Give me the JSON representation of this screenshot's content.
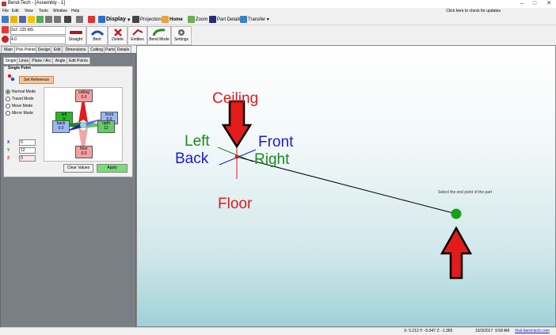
{
  "window": {
    "title": "Bend-Tech - [Assembly - 1]",
    "minimize": "–",
    "maximize": "□",
    "close": "✕"
  },
  "menu": [
    "File",
    "Edit",
    "View",
    "Tools",
    "Window",
    "Help"
  ],
  "update_notice": "Click here to check for updates",
  "toolbar": {
    "display": "Display",
    "projections": "Projections",
    "home": "Home",
    "zoom": "Zoom",
    "part_details": "Part Details",
    "transfer": "Transfer"
  },
  "ribbon": {
    "material": "2x2 .125 MS",
    "die": "4.0",
    "buttons": [
      "Straight",
      "Bent",
      "Delete",
      "Entities",
      "Bend Mode",
      "Settings"
    ]
  },
  "main_tabs": [
    "Main",
    "Pick Points",
    "Design",
    "Edit",
    "Dimensions",
    "Cutting",
    "Parts",
    "Details"
  ],
  "sub_tabs": [
    "Single",
    "Lines",
    "Plane / Arc",
    "Angle",
    "Edit Points"
  ],
  "single_point": {
    "title": "Single Point",
    "set_reference": "Set Reference",
    "modes": [
      "Normal Mode",
      "Travel Mode",
      "Move Mode",
      "Mirror Mode"
    ],
    "x_label": "X",
    "y_label": "Y",
    "z_label": "Z",
    "x_value": "0",
    "y_value": "12",
    "z_value": "0",
    "ceiling": {
      "label": "ceiling",
      "value": "0.0"
    },
    "left": {
      "label": "left",
      "value": "0"
    },
    "back": {
      "label": "back",
      "value": "0.0"
    },
    "front": {
      "label": "front",
      "value": "0.0"
    },
    "right": {
      "label": "right",
      "value": "12"
    },
    "floor": {
      "label": "floor",
      "value": "0.0"
    },
    "clear_values": "Clear Values",
    "apply": "Apply"
  },
  "viewport": {
    "labels": {
      "ceiling": "Ceiling",
      "left": "Left",
      "back": "Back",
      "front": "Front",
      "right": "Right",
      "floor": "Floor"
    },
    "hint": "Select the end point of the part"
  },
  "status": {
    "coords": "X: 5.213  Y: -5.047  Z: -1.365",
    "date": "10/3/2017",
    "time": "9:58 AM",
    "link": "Visit bend-tech.com"
  },
  "colors": {
    "red": "#e21b1b",
    "green": "#1a8a1a",
    "blue": "#1a1ad6",
    "accent_green": "#1a9a1a"
  }
}
